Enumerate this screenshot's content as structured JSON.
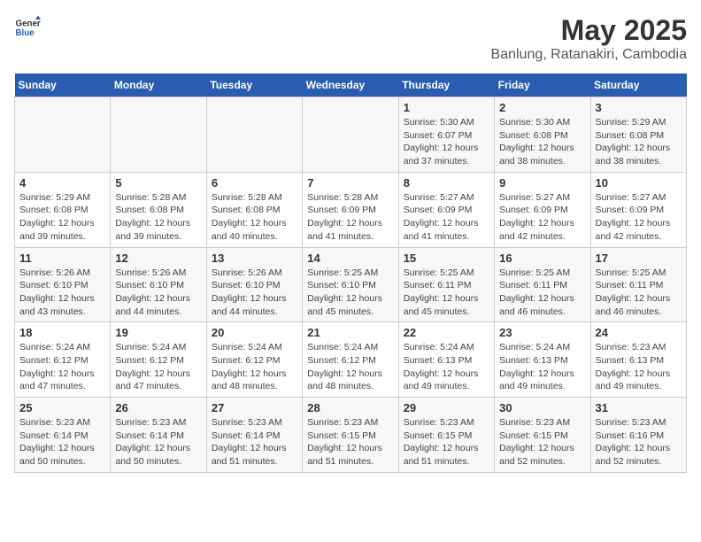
{
  "header": {
    "logo_general": "General",
    "logo_blue": "Blue",
    "title": "May 2025",
    "subtitle": "Banlung, Ratanakiri, Cambodia"
  },
  "weekdays": [
    "Sunday",
    "Monday",
    "Tuesday",
    "Wednesday",
    "Thursday",
    "Friday",
    "Saturday"
  ],
  "weeks": [
    [
      {
        "day": "",
        "info": ""
      },
      {
        "day": "",
        "info": ""
      },
      {
        "day": "",
        "info": ""
      },
      {
        "day": "",
        "info": ""
      },
      {
        "day": "1",
        "info": "Sunrise: 5:30 AM\nSunset: 6:07 PM\nDaylight: 12 hours\nand 37 minutes."
      },
      {
        "day": "2",
        "info": "Sunrise: 5:30 AM\nSunset: 6:08 PM\nDaylight: 12 hours\nand 38 minutes."
      },
      {
        "day": "3",
        "info": "Sunrise: 5:29 AM\nSunset: 6:08 PM\nDaylight: 12 hours\nand 38 minutes."
      }
    ],
    [
      {
        "day": "4",
        "info": "Sunrise: 5:29 AM\nSunset: 6:08 PM\nDaylight: 12 hours\nand 39 minutes."
      },
      {
        "day": "5",
        "info": "Sunrise: 5:28 AM\nSunset: 6:08 PM\nDaylight: 12 hours\nand 39 minutes."
      },
      {
        "day": "6",
        "info": "Sunrise: 5:28 AM\nSunset: 6:08 PM\nDaylight: 12 hours\nand 40 minutes."
      },
      {
        "day": "7",
        "info": "Sunrise: 5:28 AM\nSunset: 6:09 PM\nDaylight: 12 hours\nand 41 minutes."
      },
      {
        "day": "8",
        "info": "Sunrise: 5:27 AM\nSunset: 6:09 PM\nDaylight: 12 hours\nand 41 minutes."
      },
      {
        "day": "9",
        "info": "Sunrise: 5:27 AM\nSunset: 6:09 PM\nDaylight: 12 hours\nand 42 minutes."
      },
      {
        "day": "10",
        "info": "Sunrise: 5:27 AM\nSunset: 6:09 PM\nDaylight: 12 hours\nand 42 minutes."
      }
    ],
    [
      {
        "day": "11",
        "info": "Sunrise: 5:26 AM\nSunset: 6:10 PM\nDaylight: 12 hours\nand 43 minutes."
      },
      {
        "day": "12",
        "info": "Sunrise: 5:26 AM\nSunset: 6:10 PM\nDaylight: 12 hours\nand 44 minutes."
      },
      {
        "day": "13",
        "info": "Sunrise: 5:26 AM\nSunset: 6:10 PM\nDaylight: 12 hours\nand 44 minutes."
      },
      {
        "day": "14",
        "info": "Sunrise: 5:25 AM\nSunset: 6:10 PM\nDaylight: 12 hours\nand 45 minutes."
      },
      {
        "day": "15",
        "info": "Sunrise: 5:25 AM\nSunset: 6:11 PM\nDaylight: 12 hours\nand 45 minutes."
      },
      {
        "day": "16",
        "info": "Sunrise: 5:25 AM\nSunset: 6:11 PM\nDaylight: 12 hours\nand 46 minutes."
      },
      {
        "day": "17",
        "info": "Sunrise: 5:25 AM\nSunset: 6:11 PM\nDaylight: 12 hours\nand 46 minutes."
      }
    ],
    [
      {
        "day": "18",
        "info": "Sunrise: 5:24 AM\nSunset: 6:12 PM\nDaylight: 12 hours\nand 47 minutes."
      },
      {
        "day": "19",
        "info": "Sunrise: 5:24 AM\nSunset: 6:12 PM\nDaylight: 12 hours\nand 47 minutes."
      },
      {
        "day": "20",
        "info": "Sunrise: 5:24 AM\nSunset: 6:12 PM\nDaylight: 12 hours\nand 48 minutes."
      },
      {
        "day": "21",
        "info": "Sunrise: 5:24 AM\nSunset: 6:12 PM\nDaylight: 12 hours\nand 48 minutes."
      },
      {
        "day": "22",
        "info": "Sunrise: 5:24 AM\nSunset: 6:13 PM\nDaylight: 12 hours\nand 49 minutes."
      },
      {
        "day": "23",
        "info": "Sunrise: 5:24 AM\nSunset: 6:13 PM\nDaylight: 12 hours\nand 49 minutes."
      },
      {
        "day": "24",
        "info": "Sunrise: 5:23 AM\nSunset: 6:13 PM\nDaylight: 12 hours\nand 49 minutes."
      }
    ],
    [
      {
        "day": "25",
        "info": "Sunrise: 5:23 AM\nSunset: 6:14 PM\nDaylight: 12 hours\nand 50 minutes."
      },
      {
        "day": "26",
        "info": "Sunrise: 5:23 AM\nSunset: 6:14 PM\nDaylight: 12 hours\nand 50 minutes."
      },
      {
        "day": "27",
        "info": "Sunrise: 5:23 AM\nSunset: 6:14 PM\nDaylight: 12 hours\nand 51 minutes."
      },
      {
        "day": "28",
        "info": "Sunrise: 5:23 AM\nSunset: 6:15 PM\nDaylight: 12 hours\nand 51 minutes."
      },
      {
        "day": "29",
        "info": "Sunrise: 5:23 AM\nSunset: 6:15 PM\nDaylight: 12 hours\nand 51 minutes."
      },
      {
        "day": "30",
        "info": "Sunrise: 5:23 AM\nSunset: 6:15 PM\nDaylight: 12 hours\nand 52 minutes."
      },
      {
        "day": "31",
        "info": "Sunrise: 5:23 AM\nSunset: 6:16 PM\nDaylight: 12 hours\nand 52 minutes."
      }
    ]
  ]
}
